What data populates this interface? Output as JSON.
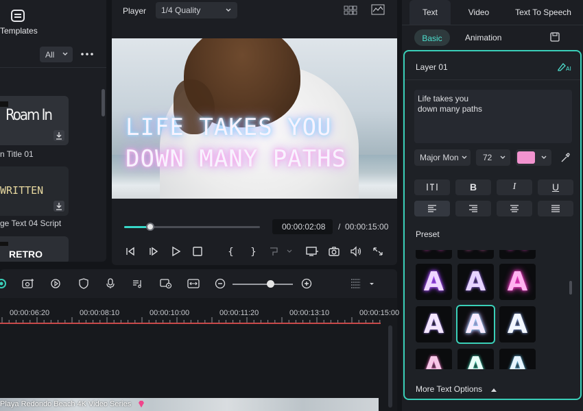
{
  "left_panel": {
    "tab_label": "Templates",
    "filter": "All",
    "templates": [
      {
        "title": "n Title 01",
        "thumb_text": "Roam In"
      },
      {
        "title": "ge Text 04 Script",
        "thumb_text": "WRITTEN"
      },
      {
        "title": "",
        "thumb_text": "RETRO"
      }
    ]
  },
  "player": {
    "label": "Player",
    "quality": "1/4 Quality",
    "overlay_line1": "LIFE TAKES YOU",
    "overlay_line2": "DOWN MANY PATHS",
    "current_time": "00:00:02:08",
    "separator": "/",
    "total_time": "00:00:15:00",
    "progress": 0.19
  },
  "right_panel": {
    "tabs": [
      "Text",
      "Video",
      "Text To Speech"
    ],
    "subtabs": [
      "Basic",
      "Animation"
    ],
    "layer_title": "Layer 01",
    "text_lines": [
      "Life takes you",
      "down many paths"
    ],
    "font": "Major Mon",
    "font_size": "72",
    "text_color": "#f293cf",
    "format_buttons": [
      "B",
      "I",
      "U"
    ],
    "preset_label": "Preset",
    "preset_glyph": "A",
    "more_options": "More Text Options"
  },
  "timeline": {
    "ruler_labels": [
      "00:00:06:20",
      "00:00:08:10",
      "00:00:10:00",
      "00:00:11:20",
      "00:00:13:10",
      "00:00:15:00"
    ],
    "clip_title": "Playa Redondo Beach 4K Video Series"
  }
}
